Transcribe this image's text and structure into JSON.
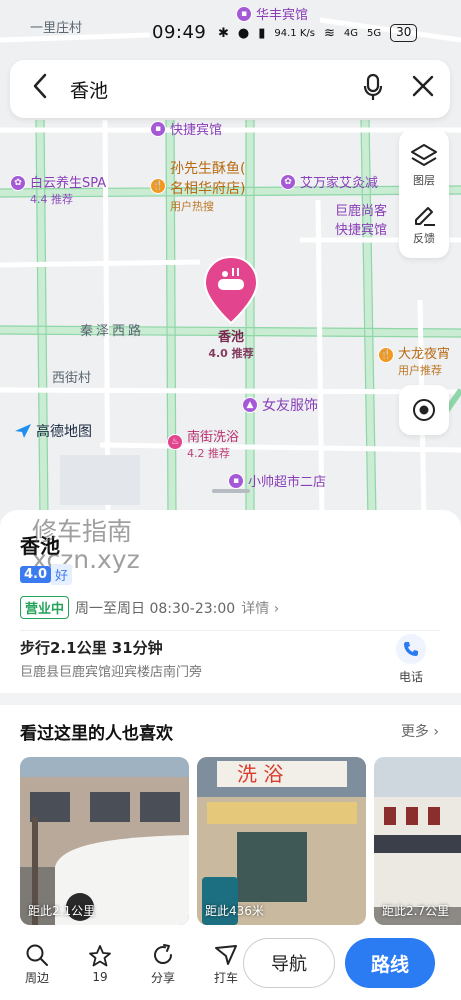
{
  "status_bar": {
    "time": "09:49",
    "network_speed": "94.1 K/s",
    "signal1": "4G",
    "signal2": "5G",
    "battery": "30"
  },
  "search": {
    "query": "香池"
  },
  "map": {
    "labels": {
      "yilizhuang": "一里庄村",
      "qinze_road": "秦泽西路",
      "xijie": "西街村"
    },
    "pois": {
      "huafeng": {
        "name": "华丰宾馆"
      },
      "kuaijie": {
        "name": "快捷宾馆"
      },
      "baiyun": {
        "name": "白云养生SPA",
        "sub": "4.4 推荐"
      },
      "sun": {
        "name": "孙先生酥鱼(",
        "name2": "名相华府店)",
        "sub": "用户热搜"
      },
      "aiwanjia": {
        "name": "艾万家艾灸减"
      },
      "julu": {
        "name": "巨鹿尚客",
        "name2": "快捷宾馆"
      },
      "dalong": {
        "name": "大龙夜宵",
        "sub": "用户推荐"
      },
      "nvyou": {
        "name": "女友服饰"
      },
      "nanjie": {
        "name": "南街洗浴",
        "sub": "4.2 推荐"
      },
      "xiaoshuai": {
        "name": "小帅超市二店"
      }
    },
    "marker": {
      "name": "香池",
      "sub": "4.0 推荐"
    },
    "logo": "高德地图",
    "tools": {
      "layers": "图层",
      "feedback": "反馈"
    }
  },
  "place": {
    "title": "香池",
    "watermark": "修车指南\nxczn.xyz",
    "score": "4.0",
    "level": "好",
    "open_status": "营业中",
    "hours": "周一至周日 08:30-23:00",
    "hours_more": "详情",
    "walk": "步行2.1公里 31分钟",
    "address": "巨鹿县巨鹿宾馆迎宾楼店南门旁",
    "phone_label": "电话"
  },
  "related": {
    "title": "看过这里的人也喜欢",
    "more": "更多",
    "items": [
      {
        "distance": "距此2.1公里"
      },
      {
        "distance": "距此436米"
      },
      {
        "distance": "距此2.7公里"
      }
    ]
  },
  "bottom_bar": {
    "nearby": "周边",
    "favorites": "19",
    "share": "分享",
    "taxi": "打车",
    "navigate": "导航",
    "route": "路线"
  },
  "colors": {
    "accent": "#2b7bf2",
    "marker": "#e2458e",
    "open": "#25a35a",
    "road": "#b7e3c6"
  }
}
